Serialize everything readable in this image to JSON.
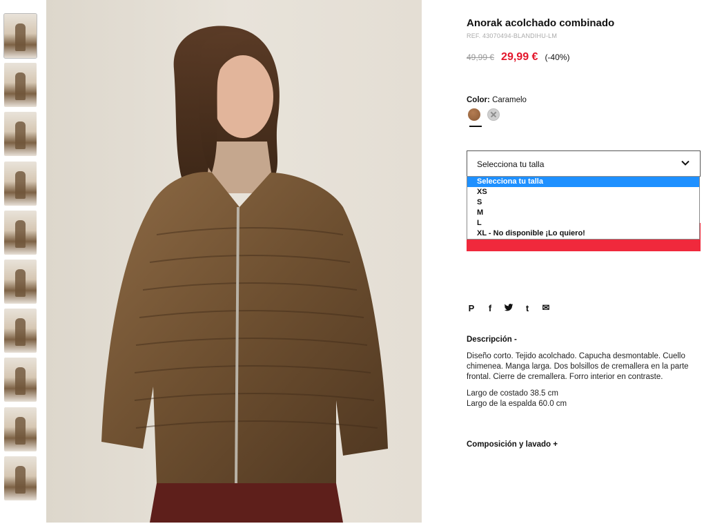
{
  "product": {
    "title": "Anorak acolchado combinado",
    "ref": "REF. 43070494-BLANDIHU-LM",
    "old_price": "49,99 €",
    "new_price": "29,99 €",
    "discount": "(-40%)"
  },
  "color": {
    "label": "Color:",
    "value": "Caramelo",
    "swatches": [
      "caramelo",
      "gris-no-disponible"
    ],
    "accent": "#e3162b"
  },
  "size": {
    "select_value": "Selecciona tu talla",
    "options": [
      "Selecciona tu talla",
      "XS",
      "S",
      "M",
      "L",
      "XL - No disponible ¡Lo quiero!"
    ],
    "highlight_color": "#1e90ff"
  },
  "social": {
    "icons": [
      "pinterest-icon",
      "facebook-icon",
      "twitter-icon",
      "tumblr-icon",
      "mail-icon"
    ],
    "glyphs": [
      "P",
      "f",
      "t",
      "t",
      "✉"
    ]
  },
  "description": {
    "heading": "Descripción -",
    "paragraph1": "Diseño corto. Tejido acolchado. Capucha desmontable. Cuello chimenea. Manga larga. Dos bolsillos de cremallera en la parte frontal. Cierre de cremallera. Forro interior en contraste.",
    "line1": "Largo de costado 38.5 cm",
    "line2": "Largo de la espalda 60.0 cm"
  },
  "composition": {
    "heading": "Composición y lavado +"
  },
  "thumbnails": {
    "count": 10,
    "selected_index": 0
  }
}
